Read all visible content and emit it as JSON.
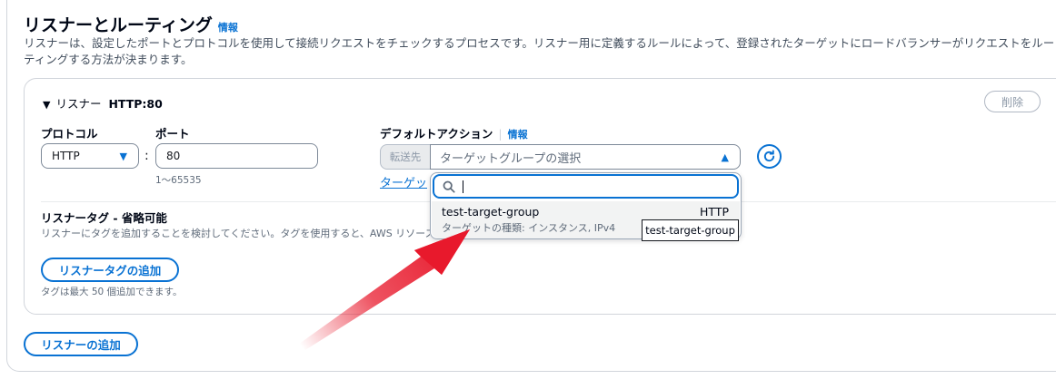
{
  "section": {
    "title": "リスナーとルーティング",
    "info_link": "情報",
    "description": "リスナーは、設定したポートとプロトコルを使用して接続リクエストをチェックするプロセスです。リスナー用に定義するルールによって、登録されたターゲットにロードバランサーがリクエストをルーティングする方法が決まります。"
  },
  "listener": {
    "header_prefix": "リスナー",
    "header_name": "HTTP:80",
    "delete_label": "削除",
    "protocol": {
      "label": "プロトコル",
      "value": "HTTP"
    },
    "port": {
      "label": "ポート",
      "value": "80",
      "hint": "1〜65535"
    },
    "default_action": {
      "label": "デフォルトアクション",
      "info_link": "情報",
      "forward_label": "転送先",
      "select_placeholder": "ターゲットグループの選択",
      "create_link": "ターゲッ"
    },
    "dropdown": {
      "option": {
        "name": "test-target-group",
        "protocol": "HTTP",
        "subtext": "ターゲットの種類: インスタンス, IPv4"
      },
      "tooltip": "test-target-group"
    },
    "tags": {
      "title": "リスナータグ - 省略可能",
      "description": "リスナーにタグを追加することを検討してください。タグを使用すると、AWS リソースの",
      "add_button": "リスナータグの追加",
      "hint": "タグは最大 50 個追加できます。"
    }
  },
  "add_listener_button": "リスナーの追加",
  "colors": {
    "accent": "#0972d3",
    "annotation_arrow": "#e8192c"
  }
}
